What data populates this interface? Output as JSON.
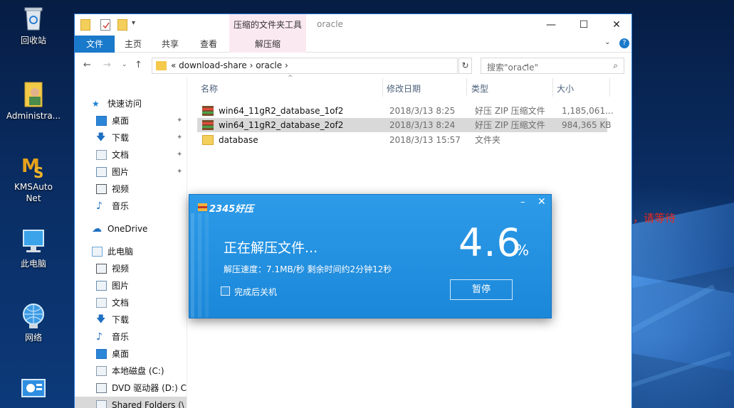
{
  "desktop": {
    "icons": [
      {
        "label": "回收站",
        "icon": "recycle-bin-icon"
      },
      {
        "label": "Administra...",
        "icon": "user-folder-icon"
      },
      {
        "label": "KMSAuto\nNet",
        "icon": "kmsauto-icon"
      },
      {
        "label": "此电脑",
        "icon": "computer-icon"
      },
      {
        "label": "网络",
        "icon": "network-icon"
      },
      {
        "label": "",
        "icon": "control-panel-icon"
      }
    ]
  },
  "annotation": {
    "text": "解压中，请等待",
    "color": "#e8291e"
  },
  "explorer": {
    "title": "oracle",
    "context_tab_group": "压缩的文件夹工具",
    "caption": {
      "minimize": "—",
      "maximize": "☐",
      "close": "✕"
    },
    "ribbon_tabs": [
      "文件",
      "主页",
      "共享",
      "查看",
      "解压缩"
    ],
    "address": {
      "segments": [
        "«",
        "download-share",
        "›",
        "oracle",
        "›"
      ],
      "text": "«  download-share  ›  oracle  ›"
    },
    "search": {
      "placeholder": "搜索\"oracle\""
    },
    "nav_pane": {
      "items": [
        {
          "label": "快速访问",
          "icon": "star-icon"
        },
        {
          "label": "桌面",
          "icon": "desktop-icon",
          "pinned": true
        },
        {
          "label": "下载",
          "icon": "download-icon",
          "pinned": true
        },
        {
          "label": "文档",
          "icon": "document-icon",
          "pinned": true
        },
        {
          "label": "图片",
          "icon": "picture-icon",
          "pinned": true
        },
        {
          "label": "视频",
          "icon": "video-icon"
        },
        {
          "label": "音乐",
          "icon": "music-icon"
        },
        {
          "label": "OneDrive",
          "icon": "cloud-icon"
        },
        {
          "label": "此电脑",
          "icon": "computer-icon"
        },
        {
          "label": "视频",
          "icon": "video-icon"
        },
        {
          "label": "图片",
          "icon": "picture-icon"
        },
        {
          "label": "文档",
          "icon": "document-icon"
        },
        {
          "label": "下载",
          "icon": "download-icon"
        },
        {
          "label": "音乐",
          "icon": "music-icon"
        },
        {
          "label": "桌面",
          "icon": "desktop-icon"
        },
        {
          "label": "本地磁盘 (C:)",
          "icon": "drive-icon"
        },
        {
          "label": "DVD 驱动器 (D:) C",
          "icon": "dvd-icon"
        },
        {
          "label": "Shared Folders (\\",
          "icon": "shared-folder-icon"
        }
      ]
    },
    "columns": [
      "名称",
      "修改日期",
      "类型",
      "大小"
    ],
    "files": [
      {
        "name": "win64_11gR2_database_1of2",
        "date": "2018/3/13 8:25",
        "type": "好压 ZIP 压缩文件",
        "size": "1,185,061...",
        "icon": "zip-archive-icon",
        "selected": false
      },
      {
        "name": "win64_11gR2_database_2of2",
        "date": "2018/3/13 8:24",
        "type": "好压 ZIP 压缩文件",
        "size": "984,365 KB",
        "icon": "zip-archive-icon",
        "selected": true
      },
      {
        "name": "database",
        "date": "2018/3/13 15:57",
        "type": "文件夹",
        "size": "",
        "icon": "folder-icon",
        "selected": false
      }
    ]
  },
  "dialog": {
    "brand": "2345好压",
    "status": "正在解压文件...",
    "percent": "4.6",
    "percent_sign": "%",
    "progress": 0.046,
    "info": "解压速度：7.1MB/秒  剩余时间约2分钟12秒",
    "shutdown_label": "完成后关机",
    "shutdown_checked": false,
    "pause_label": "暂停",
    "minimize": "–",
    "close": "✕"
  }
}
